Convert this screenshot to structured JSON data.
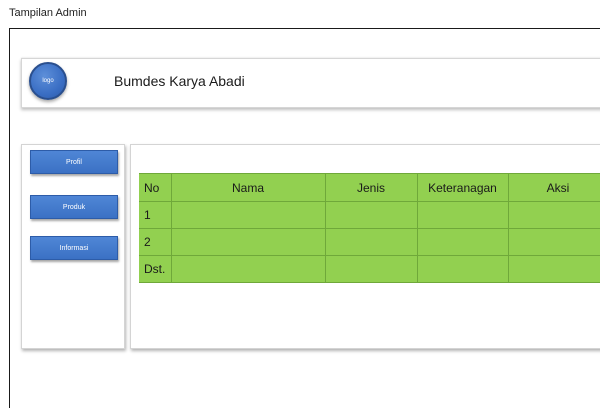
{
  "caption": "Tampilan Admin",
  "header": {
    "logo_text": "logo",
    "title": "Bumdes Karya Abadi"
  },
  "sidebar": {
    "items": [
      {
        "label": "Profil"
      },
      {
        "label": "Produk"
      },
      {
        "label": "Informasi"
      }
    ]
  },
  "table": {
    "columns": [
      "No",
      "Nama",
      "Jenis",
      "Keteranagan",
      "Aksi"
    ],
    "rows": [
      [
        "1",
        "",
        "",
        "",
        ""
      ],
      [
        "2",
        "",
        "",
        "",
        ""
      ],
      [
        "Dst.",
        "",
        "",
        "",
        ""
      ]
    ]
  },
  "colors": {
    "table_fill": "#92d050",
    "button_blue": "#4472c4"
  }
}
